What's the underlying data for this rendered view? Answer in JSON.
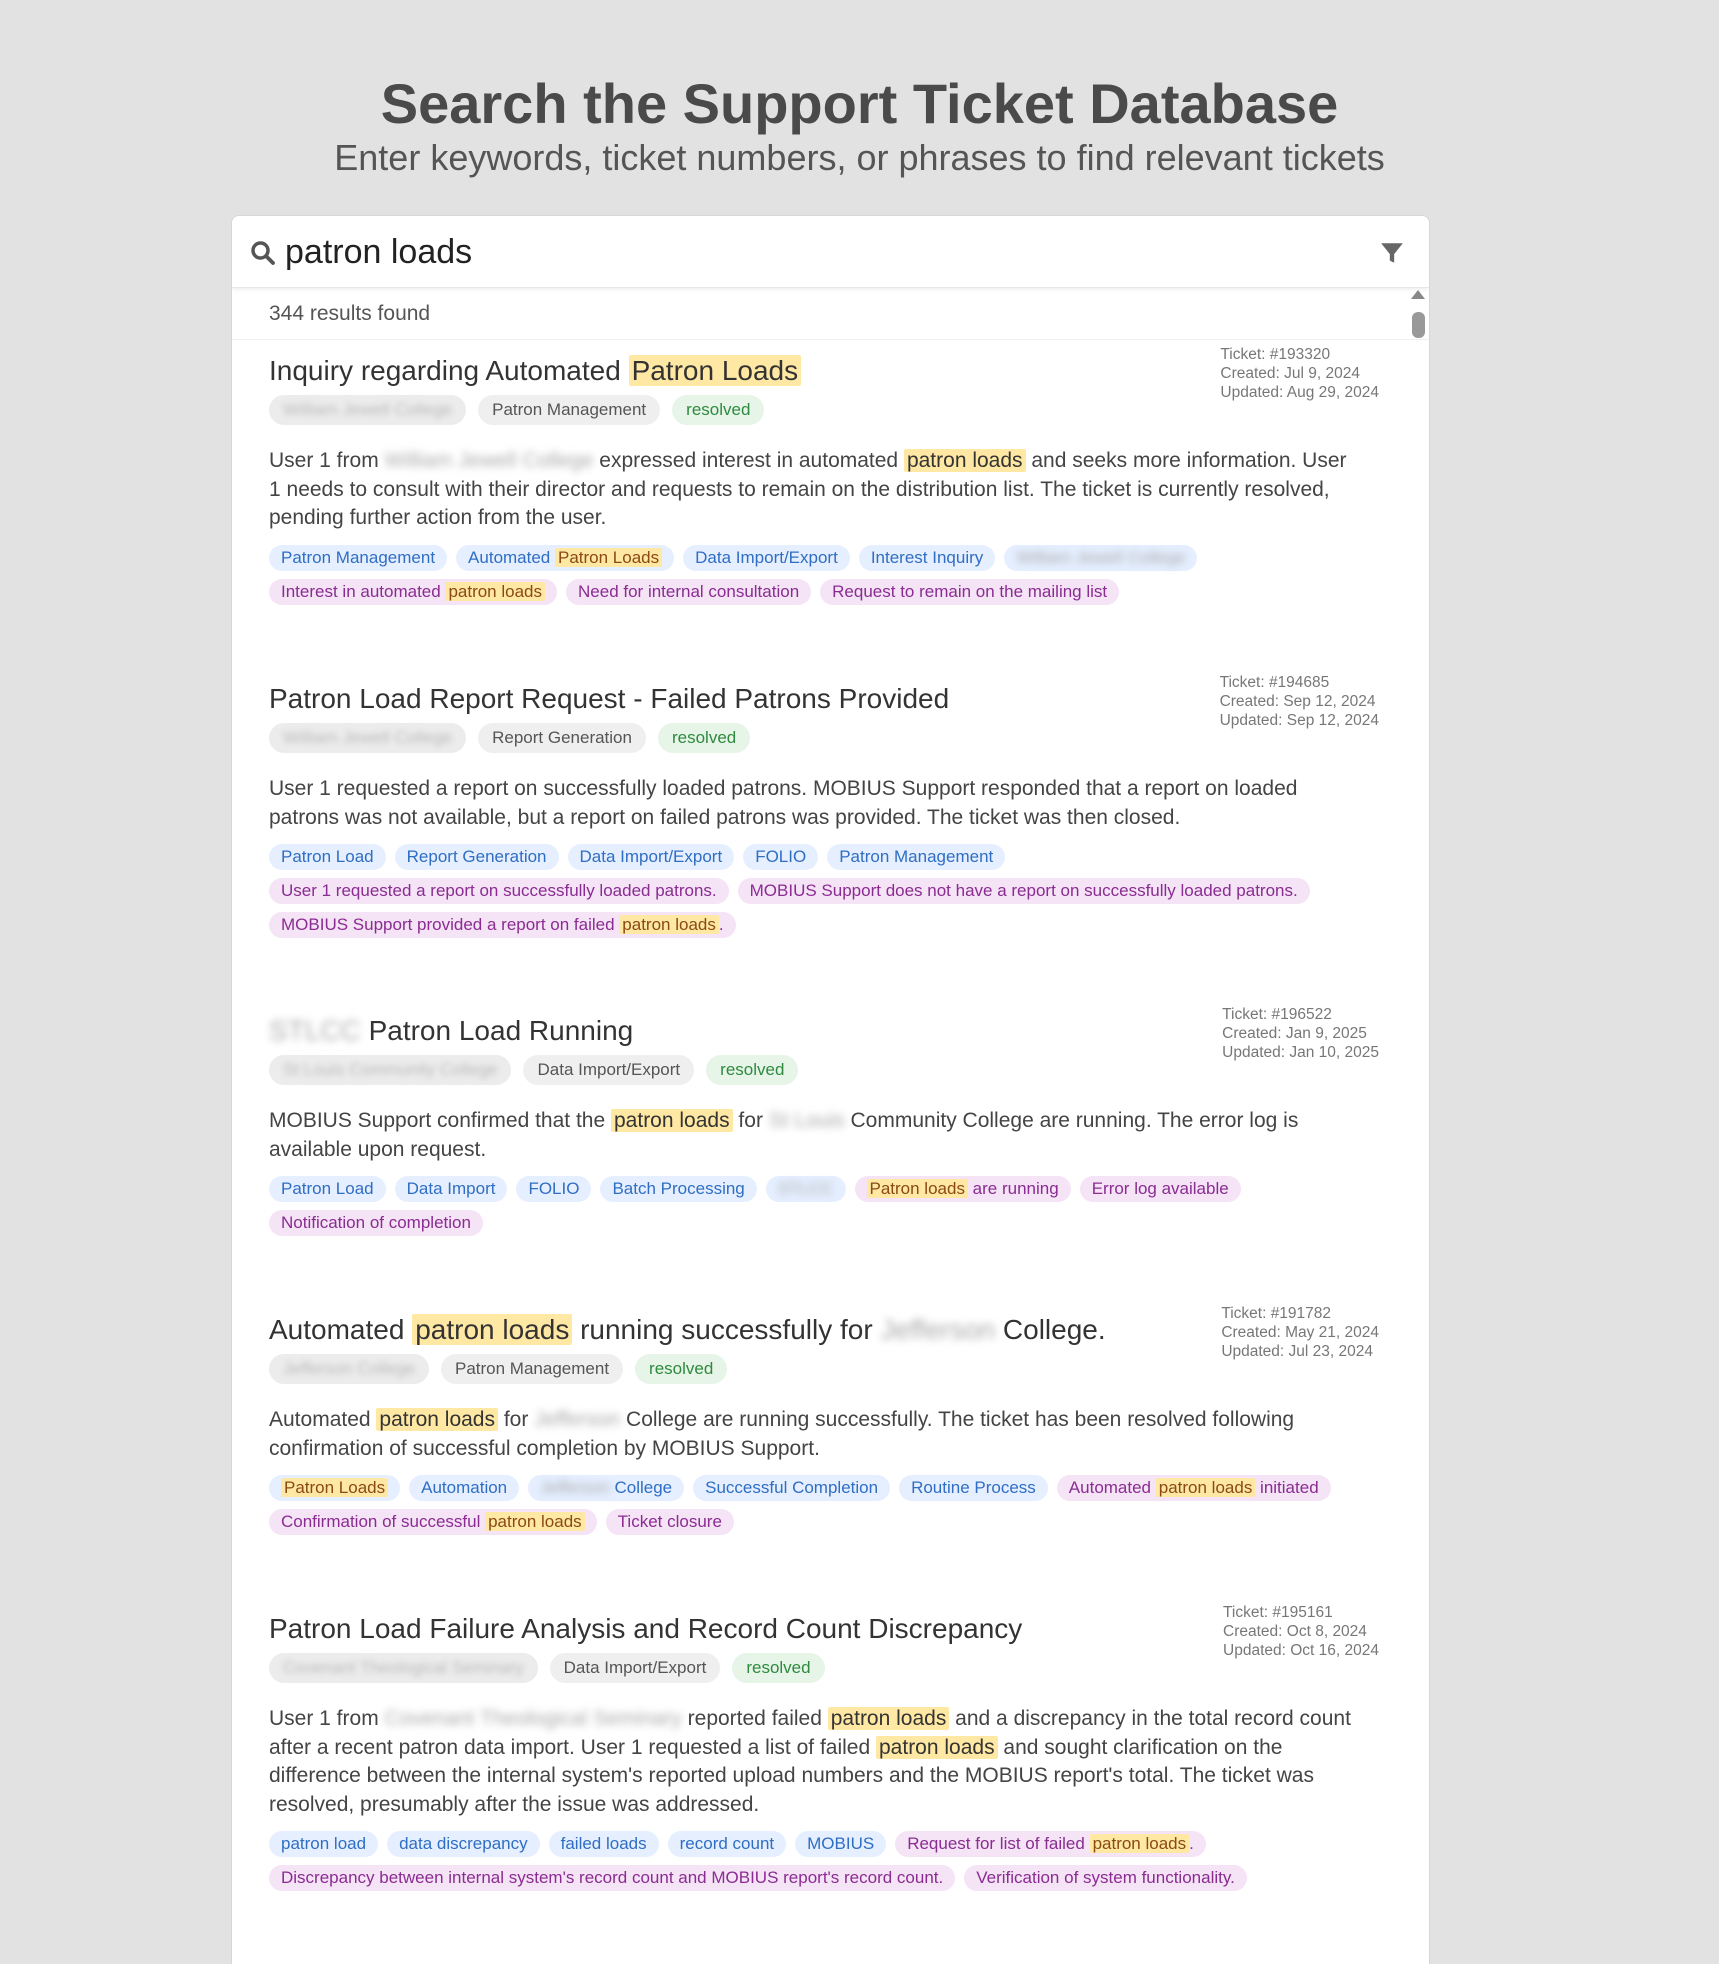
{
  "header": {
    "title": "Search the Support Ticket Database",
    "subtitle": "Enter keywords, ticket numbers, or phrases to find relevant tickets"
  },
  "search": {
    "value": "patron loads",
    "placeholder": ""
  },
  "results": {
    "count_label": "344 results found"
  },
  "colors": {
    "highlight": "#ffe8a3",
    "tag_blue": "#e5efff",
    "tag_purple": "#f5e3f6",
    "status_green": "#e6f5e8"
  },
  "icons": {
    "search": "search-icon",
    "filter": "filter-icon"
  },
  "tickets": [
    {
      "title": [
        "Inquiry regarding Automated ",
        "Patron Loads",
        ""
      ],
      "ticket": "Ticket: #193320",
      "created": "Created: Jul 9, 2024",
      "updated": "Updated: Aug 29, 2024",
      "org": "William Jewell College",
      "category": "Patron Management",
      "status": "resolved",
      "summary": [
        "User 1 from ",
        "William Jewell College",
        " expressed interest in automated ",
        "patron loads",
        " and seeks more information. User 1 needs to consult with their director and requests to remain on the distribution list. The ticket is currently resolved, pending further action from the user."
      ],
      "tags_blue": [
        "Patron Management",
        "Automated Patron Loads",
        "Data Import/Export",
        "Interest Inquiry",
        "William Jewell College"
      ],
      "tags_purple": [
        "Interest in automated patron loads",
        "Need for internal consultation",
        "Request to remain on the mailing list"
      ]
    },
    {
      "title": [
        "Patron Load Report Request - Failed Patrons Provided"
      ],
      "ticket": "Ticket: #194685",
      "created": "Created: Sep 12, 2024",
      "updated": "Updated: Sep 12, 2024",
      "org": "William Jewell College",
      "category": "Report Generation",
      "status": "resolved",
      "summary": [
        "User 1 requested a report on successfully loaded patrons. MOBIUS Support responded that a report on loaded patrons was not available, but a report on failed patrons was provided. The ticket was then closed."
      ],
      "tags_blue": [
        "Patron Load",
        "Report Generation",
        "Data Import/Export",
        "FOLIO",
        "Patron Management"
      ],
      "tags_purple": [
        "User 1 requested a report on successfully loaded patrons.",
        "MOBIUS Support does not have a report on successfully loaded patrons.",
        "MOBIUS Support provided a report on failed patron loads."
      ]
    },
    {
      "title": [
        "STLCC",
        " Patron Load Running"
      ],
      "ticket": "Ticket: #196522",
      "created": "Created: Jan 9, 2025",
      "updated": "Updated: Jan 10, 2025",
      "org": "St Louis Community College",
      "category": "Data Import/Export",
      "status": "resolved",
      "summary": [
        "MOBIUS Support confirmed that the ",
        "patron loads",
        " for ",
        "St Louis",
        " Community College are running. The error log is available upon request."
      ],
      "tags_blue": [
        "Patron Load",
        "Data Import",
        "FOLIO",
        "Batch Processing",
        "STLCC"
      ],
      "tags_purple": [
        "Patron loads are running",
        "Error log available",
        "Notification of completion"
      ]
    },
    {
      "title": [
        "Automated ",
        "patron loads",
        " running successfully for ",
        "Jefferson",
        " College."
      ],
      "ticket": "Ticket: #191782",
      "created": "Created: May 21, 2024",
      "updated": "Updated: Jul 23, 2024",
      "org": "Jefferson College",
      "category": "Patron Management",
      "status": "resolved",
      "summary": [
        "Automated ",
        "patron loads",
        " for ",
        "Jefferson",
        " College are running successfully. The ticket has been resolved following confirmation of successful completion by MOBIUS Support."
      ],
      "tags_blue": [
        "Patron Loads",
        "Automation",
        "Jefferson College",
        "Successful Completion",
        "Routine Process"
      ],
      "tags_purple": [
        "Automated patron loads initiated",
        "Confirmation of successful patron loads",
        "Ticket closure"
      ]
    },
    {
      "title": [
        "Patron Load Failure Analysis and Record Count Discrepancy"
      ],
      "ticket": "Ticket: #195161",
      "created": "Created: Oct 8, 2024",
      "updated": "Updated: Oct 16, 2024",
      "org": "Covenant Theological Seminary",
      "category": "Data Import/Export",
      "status": "resolved",
      "summary": [
        "User 1 from ",
        "Covenant Theological Seminary",
        " reported failed ",
        "patron loads",
        " and a discrepancy in the total record count after a recent patron data import. User 1 requested a list of failed ",
        "patron loads",
        " and sought clarification on the difference between the internal system's reported upload numbers and the MOBIUS report's total. The ticket was resolved, presumably after the issue was addressed."
      ],
      "tags_blue": [
        "patron load",
        "data discrepancy",
        "failed loads",
        "record count",
        "MOBIUS"
      ],
      "tags_purple": [
        "Request for list of failed patron loads.",
        "Discrepancy between internal system's record count and MOBIUS report's record count.",
        "Verification of system functionality."
      ]
    }
  ]
}
